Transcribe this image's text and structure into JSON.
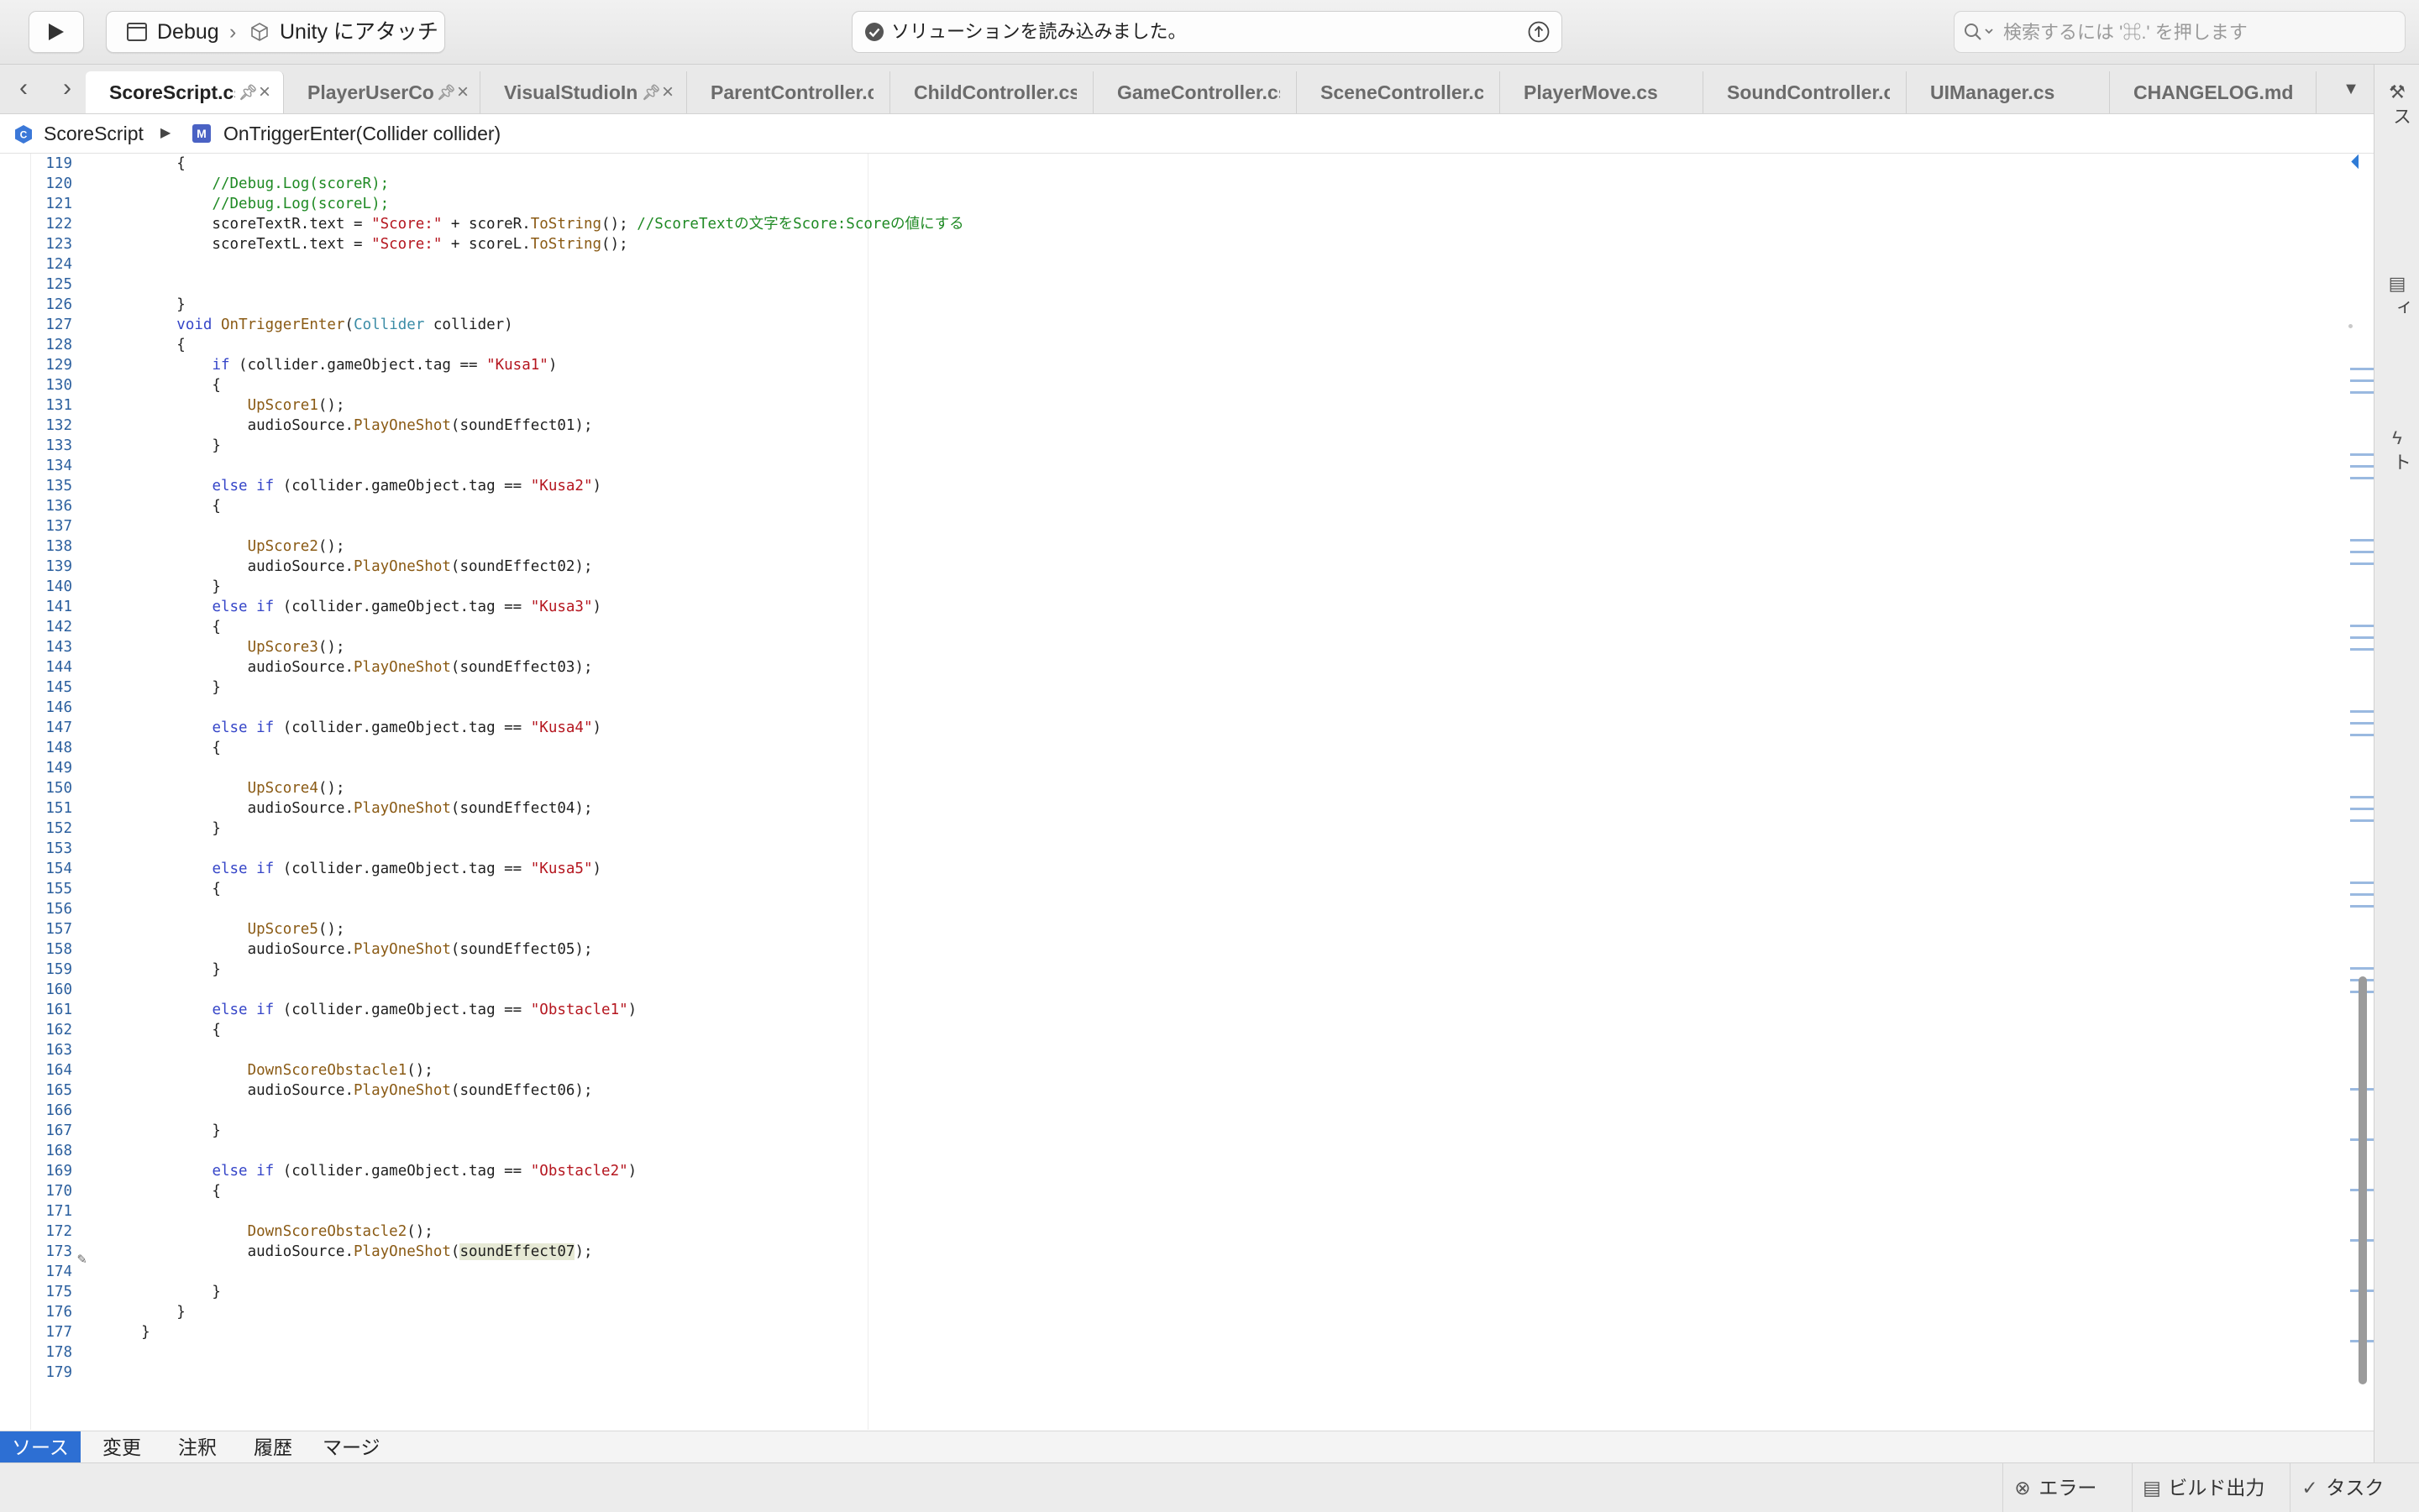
{
  "toolbar": {
    "configuration": "Debug",
    "separator": "›",
    "target": "Unity にアタッチ",
    "status_text": "ソリューションを読み込みました。",
    "search_placeholder": "検索するには '⌘.' を押します"
  },
  "tabs": [
    {
      "label": "ScoreScript.cs",
      "active": true,
      "pinned": true,
      "closable": true
    },
    {
      "label": "PlayerUserController.cs",
      "active": false,
      "pinned": true,
      "closable": true
    },
    {
      "label": "VisualStudioIntegration.cs",
      "active": false,
      "pinned": true,
      "closable": true
    },
    {
      "label": "ParentController.cs",
      "active": false,
      "pinned": false,
      "closable": false
    },
    {
      "label": "ChildController.cs",
      "active": false,
      "pinned": false,
      "closable": false
    },
    {
      "label": "GameController.cs",
      "active": false,
      "pinned": false,
      "closable": false
    },
    {
      "label": "SceneController.cs",
      "active": false,
      "pinned": false,
      "closable": false
    },
    {
      "label": "PlayerMove.cs",
      "active": false,
      "pinned": false,
      "closable": false
    },
    {
      "label": "SoundController.cs",
      "active": false,
      "pinned": false,
      "closable": false
    },
    {
      "label": "UIManager.cs",
      "active": false,
      "pinned": false,
      "closable": false
    },
    {
      "label": "CHANGELOG.md",
      "active": false,
      "pinned": false,
      "closable": false
    }
  ],
  "breadcrumb": {
    "class_name": "ScoreScript",
    "method_name": "OnTriggerEnter(Collider collider)"
  },
  "editor": {
    "lines": [
      {
        "n": "119",
        "tokens": [
          [
            "        ",
            ""
          ],
          [
            "{",
            ""
          ]
        ]
      },
      {
        "n": "120",
        "tokens": [
          [
            "            ",
            ""
          ],
          [
            "//Debug.Log(scoreR);",
            "cmt"
          ]
        ]
      },
      {
        "n": "121",
        "tokens": [
          [
            "            ",
            ""
          ],
          [
            "//Debug.Log(scoreL);",
            "cmt"
          ]
        ]
      },
      {
        "n": "122",
        "tokens": [
          [
            "            scoreTextR.text = ",
            ""
          ],
          [
            "\"Score:\"",
            "str"
          ],
          [
            " + scoreR.",
            ""
          ],
          [
            "ToString",
            "fn"
          ],
          [
            "(); ",
            ""
          ],
          [
            "//ScoreTextの文字をScore:Scoreの値にする",
            "cmt"
          ]
        ]
      },
      {
        "n": "123",
        "tokens": [
          [
            "            scoreTextL.text = ",
            ""
          ],
          [
            "\"Score:\"",
            "str"
          ],
          [
            " + scoreL.",
            ""
          ],
          [
            "ToString",
            "fn"
          ],
          [
            "();",
            ""
          ]
        ]
      },
      {
        "n": "124",
        "tokens": []
      },
      {
        "n": "125",
        "tokens": []
      },
      {
        "n": "126",
        "tokens": [
          [
            "        }",
            ""
          ]
        ]
      },
      {
        "n": "127",
        "tokens": [
          [
            "        ",
            ""
          ],
          [
            "void",
            "kw"
          ],
          [
            " ",
            ""
          ],
          [
            "OnTriggerEnter",
            "fn"
          ],
          [
            "(",
            ""
          ],
          [
            "Collider",
            "type"
          ],
          [
            " collider)",
            ""
          ]
        ]
      },
      {
        "n": "128",
        "tokens": [
          [
            "        {",
            ""
          ]
        ]
      },
      {
        "n": "129",
        "tokens": [
          [
            "            ",
            ""
          ],
          [
            "if",
            "kw"
          ],
          [
            " (collider.gameObject.tag == ",
            ""
          ],
          [
            "\"Kusa1\"",
            "str"
          ],
          [
            ")",
            ""
          ]
        ]
      },
      {
        "n": "130",
        "tokens": [
          [
            "            {",
            ""
          ]
        ]
      },
      {
        "n": "131",
        "tokens": [
          [
            "                ",
            ""
          ],
          [
            "UpScore1",
            "fn"
          ],
          [
            "();",
            ""
          ]
        ]
      },
      {
        "n": "132",
        "tokens": [
          [
            "                audioSource.",
            ""
          ],
          [
            "PlayOneShot",
            "fn"
          ],
          [
            "(soundEffect01);",
            ""
          ]
        ]
      },
      {
        "n": "133",
        "tokens": [
          [
            "            }",
            ""
          ]
        ]
      },
      {
        "n": "134",
        "tokens": []
      },
      {
        "n": "135",
        "tokens": [
          [
            "            ",
            ""
          ],
          [
            "else if",
            "kw"
          ],
          [
            " (collider.gameObject.tag == ",
            ""
          ],
          [
            "\"Kusa2\"",
            "str"
          ],
          [
            ")",
            ""
          ]
        ]
      },
      {
        "n": "136",
        "tokens": [
          [
            "            {",
            ""
          ]
        ]
      },
      {
        "n": "137",
        "tokens": []
      },
      {
        "n": "138",
        "tokens": [
          [
            "                ",
            ""
          ],
          [
            "UpScore2",
            "fn"
          ],
          [
            "();",
            ""
          ]
        ]
      },
      {
        "n": "139",
        "tokens": [
          [
            "                audioSource.",
            ""
          ],
          [
            "PlayOneShot",
            "fn"
          ],
          [
            "(soundEffect02);",
            ""
          ]
        ]
      },
      {
        "n": "140",
        "tokens": [
          [
            "            }",
            ""
          ]
        ]
      },
      {
        "n": "141",
        "tokens": [
          [
            "            ",
            ""
          ],
          [
            "else if",
            "kw"
          ],
          [
            " (collider.gameObject.tag == ",
            ""
          ],
          [
            "\"Kusa3\"",
            "str"
          ],
          [
            ")",
            ""
          ]
        ]
      },
      {
        "n": "142",
        "tokens": [
          [
            "            {",
            ""
          ]
        ]
      },
      {
        "n": "143",
        "tokens": [
          [
            "                ",
            ""
          ],
          [
            "UpScore3",
            "fn"
          ],
          [
            "();",
            ""
          ]
        ]
      },
      {
        "n": "144",
        "tokens": [
          [
            "                audioSource.",
            ""
          ],
          [
            "PlayOneShot",
            "fn"
          ],
          [
            "(soundEffect03);",
            ""
          ]
        ]
      },
      {
        "n": "145",
        "tokens": [
          [
            "            }",
            ""
          ]
        ]
      },
      {
        "n": "146",
        "tokens": []
      },
      {
        "n": "147",
        "tokens": [
          [
            "            ",
            ""
          ],
          [
            "else if",
            "kw"
          ],
          [
            " (collider.gameObject.tag == ",
            ""
          ],
          [
            "\"Kusa4\"",
            "str"
          ],
          [
            ")",
            ""
          ]
        ]
      },
      {
        "n": "148",
        "tokens": [
          [
            "            {",
            ""
          ]
        ]
      },
      {
        "n": "149",
        "tokens": []
      },
      {
        "n": "150",
        "tokens": [
          [
            "                ",
            ""
          ],
          [
            "UpScore4",
            "fn"
          ],
          [
            "();",
            ""
          ]
        ]
      },
      {
        "n": "151",
        "tokens": [
          [
            "                audioSource.",
            ""
          ],
          [
            "PlayOneShot",
            "fn"
          ],
          [
            "(soundEffect04);",
            ""
          ]
        ]
      },
      {
        "n": "152",
        "tokens": [
          [
            "            }",
            ""
          ]
        ]
      },
      {
        "n": "153",
        "tokens": []
      },
      {
        "n": "154",
        "tokens": [
          [
            "            ",
            ""
          ],
          [
            "else if",
            "kw"
          ],
          [
            " (collider.gameObject.tag == ",
            ""
          ],
          [
            "\"Kusa5\"",
            "str"
          ],
          [
            ")",
            ""
          ]
        ]
      },
      {
        "n": "155",
        "tokens": [
          [
            "            {",
            ""
          ]
        ]
      },
      {
        "n": "156",
        "tokens": []
      },
      {
        "n": "157",
        "tokens": [
          [
            "                ",
            ""
          ],
          [
            "UpScore5",
            "fn"
          ],
          [
            "();",
            ""
          ]
        ]
      },
      {
        "n": "158",
        "tokens": [
          [
            "                audioSource.",
            ""
          ],
          [
            "PlayOneShot",
            "fn"
          ],
          [
            "(soundEffect05);",
            ""
          ]
        ]
      },
      {
        "n": "159",
        "tokens": [
          [
            "            }",
            ""
          ]
        ]
      },
      {
        "n": "160",
        "tokens": []
      },
      {
        "n": "161",
        "tokens": [
          [
            "            ",
            ""
          ],
          [
            "else if",
            "kw"
          ],
          [
            " (collider.gameObject.tag == ",
            ""
          ],
          [
            "\"Obstacle1\"",
            "str"
          ],
          [
            ")",
            ""
          ]
        ]
      },
      {
        "n": "162",
        "tokens": [
          [
            "            {",
            ""
          ]
        ]
      },
      {
        "n": "163",
        "tokens": []
      },
      {
        "n": "164",
        "tokens": [
          [
            "                ",
            ""
          ],
          [
            "DownScoreObstacle1",
            "fn"
          ],
          [
            "();",
            ""
          ]
        ]
      },
      {
        "n": "165",
        "tokens": [
          [
            "                audioSource.",
            ""
          ],
          [
            "PlayOneShot",
            "fn"
          ],
          [
            "(soundEffect06);",
            ""
          ]
        ]
      },
      {
        "n": "166",
        "tokens": []
      },
      {
        "n": "167",
        "tokens": [
          [
            "            }",
            ""
          ]
        ]
      },
      {
        "n": "168",
        "tokens": []
      },
      {
        "n": "169",
        "tokens": [
          [
            "            ",
            ""
          ],
          [
            "else if",
            "kw"
          ],
          [
            " (collider.gameObject.tag == ",
            ""
          ],
          [
            "\"Obstacle2\"",
            "str"
          ],
          [
            ")",
            ""
          ]
        ]
      },
      {
        "n": "170",
        "tokens": [
          [
            "            {",
            ""
          ]
        ]
      },
      {
        "n": "171",
        "tokens": []
      },
      {
        "n": "172",
        "tokens": [
          [
            "                ",
            ""
          ],
          [
            "DownScoreObstacle2",
            "fn"
          ],
          [
            "();",
            ""
          ]
        ]
      },
      {
        "n": "173",
        "tokens": [
          [
            "                audioSource.",
            ""
          ],
          [
            "PlayOneShot",
            "fn"
          ],
          [
            "(",
            ""
          ],
          [
            "soundEffect07",
            "hl"
          ],
          [
            ");",
            ""
          ]
        ]
      },
      {
        "n": "174",
        "tokens": []
      },
      {
        "n": "175",
        "tokens": [
          [
            "            }",
            ""
          ]
        ]
      },
      {
        "n": "176",
        "tokens": [
          [
            "        }",
            ""
          ]
        ]
      },
      {
        "n": "177",
        "tokens": [
          [
            "    }",
            ""
          ]
        ]
      },
      {
        "n": "178",
        "tokens": []
      },
      {
        "n": "179",
        "tokens": []
      }
    ]
  },
  "right_panel": [
    {
      "icon": "wrench-icon",
      "label": "ツールボックス"
    },
    {
      "icon": "properties-icon",
      "label": "プロパティ"
    },
    {
      "icon": "lightning-icon",
      "label": "テスト"
    }
  ],
  "bottom_tabs": [
    "ソース",
    "変更",
    "注釈",
    "履歴",
    "マージ"
  ],
  "status_bar": {
    "errors": "エラー",
    "build_output": "ビルド出力",
    "tasks": "タスク"
  },
  "colors": {
    "keyword": "#3646c8",
    "type": "#3b8ca6",
    "string": "#b5161f",
    "comment": "#1f8a24",
    "method": "#8a5a14",
    "line_number": "#2b5f9e",
    "accent": "#2d6fd3"
  }
}
